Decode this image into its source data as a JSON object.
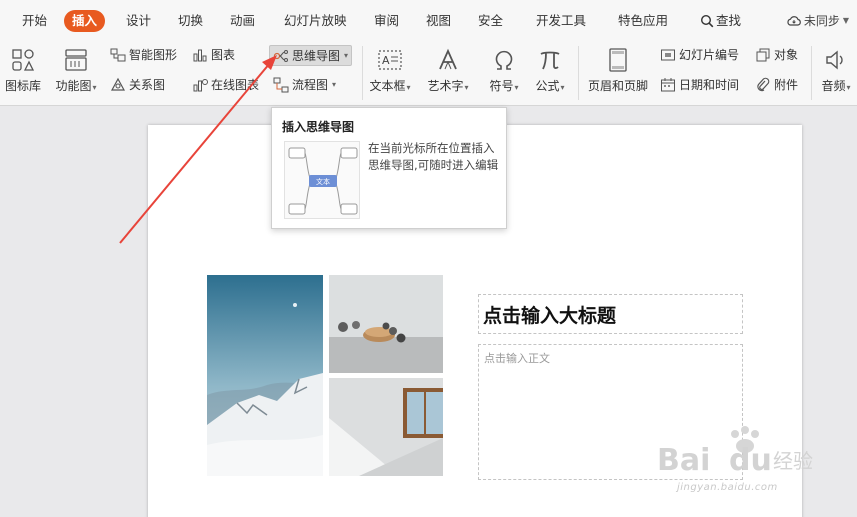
{
  "menu": {
    "tabs": [
      "开始",
      "插入",
      "设计",
      "切换",
      "动画",
      "幻灯片放映",
      "审阅",
      "视图",
      "安全",
      "开发工具",
      "特色应用"
    ],
    "active_tab": "插入",
    "search_label": "查找",
    "sync_label": "未同步"
  },
  "ribbon": {
    "icon_library": "图标库",
    "function_chart": "功能图",
    "smart_graphic": "智能图形",
    "chart": "图表",
    "relation_chart": "关系图",
    "online_chart": "在线图表",
    "mind_map": "思维导图",
    "flow_chart": "流程图",
    "text_box": "文本框",
    "word_art": "艺术字",
    "symbol": "符号",
    "formula": "公式",
    "header_footer": "页眉和页脚",
    "slide_number": "幻灯片编号",
    "object": "对象",
    "date_time": "日期和时间",
    "attachment": "附件",
    "audio": "音频"
  },
  "tooltip": {
    "title": "插入思维导图",
    "preview_label": "文本",
    "description": "在当前光标所在位置插入思维导图,可随时进入编辑"
  },
  "slide": {
    "title_placeholder": "点击输入大标题",
    "body_placeholder": "点击输入正文"
  },
  "watermark": {
    "brand": "Baidu经验",
    "url": "jingyan.baidu.com"
  },
  "colors": {
    "accent": "#e85a20",
    "annotation_arrow": "#e8443a"
  }
}
